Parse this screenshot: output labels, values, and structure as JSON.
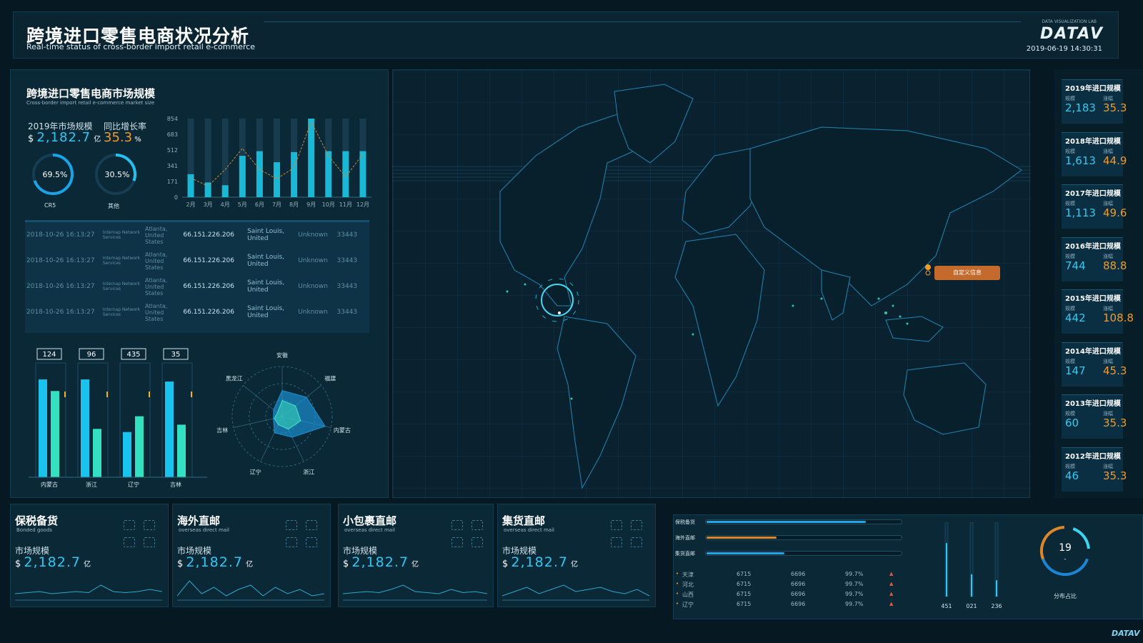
{
  "header": {
    "title": "跨境进口零售电商状况分析",
    "subtitle": "Real-time status of cross-border import retail e-commerce",
    "logo_small": "DATA VISUALIZATION LAB",
    "logo": "DATAV",
    "datetime": "2019-06-19 14:30:31"
  },
  "market": {
    "title": "跨境进口零售电商市场规模",
    "subtitle": "Cross-border import retail e-commerce market size",
    "scale_label": "2019年市场规模",
    "scale_currency": "$",
    "scale_value": "2,182.7",
    "scale_unit": "亿",
    "growth_label": "同比增长率",
    "growth_value": "35.3",
    "growth_unit": "%",
    "gauges": [
      {
        "label": "CR5",
        "value": "69.5%",
        "fraction": 0.695
      },
      {
        "label": "其他",
        "value": "30.5%",
        "fraction": 0.305
      }
    ]
  },
  "chart_data": [
    {
      "type": "bar",
      "categories": [
        "2月",
        "3月",
        "4月",
        "5月",
        "6月",
        "7月",
        "8月",
        "9月",
        "10月",
        "11月",
        "12月"
      ],
      "series": [
        {
          "values": [
            250,
            160,
            130,
            450,
            500,
            380,
            490,
            854,
            500,
            500,
            500
          ]
        }
      ],
      "line_values": [
        210,
        120,
        300,
        530,
        300,
        200,
        320,
        820,
        450,
        220,
        470
      ],
      "yticks": [
        "854",
        "683",
        "512",
        "341",
        "171",
        "0"
      ],
      "ylim": [
        0,
        854
      ]
    },
    {
      "type": "bar",
      "categories": [
        "内蒙古",
        "浙江",
        "辽宁",
        "吉林"
      ],
      "series": [
        {
          "values": [
            124,
            96,
            435,
            35
          ],
          "top_labels": [
            "124",
            "96",
            "435",
            "35"
          ]
        },
        {
          "values": [
            0.93,
            0.93,
            0.43,
            0.91
          ]
        },
        {
          "values": [
            0.82,
            0.46,
            0.58,
            0.5
          ]
        }
      ]
    },
    {
      "type": "radar",
      "axes": [
        "安徽",
        "福建",
        "内蒙古",
        "浙江",
        "辽宁",
        "吉林",
        "黑龙江"
      ],
      "series": [
        {
          "values": [
            0.52,
            0.62,
            0.88,
            0.46,
            0.36,
            0.18,
            0.22
          ]
        },
        {
          "values": [
            0.32,
            0.34,
            0.38,
            0.28,
            0.18,
            0.16,
            0.12
          ]
        }
      ]
    }
  ],
  "log_rows": [
    {
      "time": "2018-10-26 16:13:27",
      "org": "Internap Network Services",
      "city": "Atlanta, United States",
      "ip": "66.151.226.206",
      "dest": "Saint Louis, United",
      "status": "Unknown",
      "port": "33443"
    },
    {
      "time": "2018-10-26 16:13:27",
      "org": "Internap Network Services",
      "city": "Atlanta, United States",
      "ip": "66.151.226.206",
      "dest": "Saint Louis, United",
      "status": "Unknown",
      "port": "33443"
    },
    {
      "time": "2018-10-26 16:13:27",
      "org": "Internap Network Services",
      "city": "Atlanta, United States",
      "ip": "66.151.226.206",
      "dest": "Saint Louis, United",
      "status": "Unknown",
      "port": "33443"
    },
    {
      "time": "2018-10-26 16:13:27",
      "org": "Internap Network Services",
      "city": "Atlanta, United States",
      "ip": "66.151.226.206",
      "dest": "Saint Louis, United",
      "status": "Unknown",
      "port": "33443"
    }
  ],
  "map": {
    "tooltip": "自定义信息"
  },
  "yearly": [
    {
      "title": "2019年进口规模",
      "l1": "规模",
      "l2": "涨幅",
      "v1": "2,183",
      "v2": "35.3"
    },
    {
      "title": "2018年进口规模",
      "l1": "规模",
      "l2": "涨幅",
      "v1": "1,613",
      "v2": "44.9"
    },
    {
      "title": "2017年进口规模",
      "l1": "规模",
      "l2": "涨幅",
      "v1": "1,113",
      "v2": "49.6"
    },
    {
      "title": "2016年进口规模",
      "l1": "规模",
      "l2": "涨幅",
      "v1": "744",
      "v2": "88.8"
    },
    {
      "title": "2015年进口规模",
      "l1": "规模",
      "l2": "涨幅",
      "v1": "442",
      "v2": "108.8"
    },
    {
      "title": "2014年进口规模",
      "l1": "规模",
      "l2": "涨幅",
      "v1": "147",
      "v2": "45.3"
    },
    {
      "title": "2013年进口规模",
      "l1": "规模",
      "l2": "涨幅",
      "v1": "60",
      "v2": "35.3"
    },
    {
      "title": "2012年进口规模",
      "l1": "规模",
      "l2": "涨幅",
      "v1": "46",
      "v2": "35.3"
    }
  ],
  "bottom_cards": [
    {
      "title": "保税备货",
      "subtitle": "Bonded goods",
      "label": "市场规模",
      "currency": "$",
      "value": "2,182.7",
      "unit": "亿"
    },
    {
      "title": "海外直邮",
      "subtitle": "overseas direct mail",
      "label": "市场规模",
      "currency": "$",
      "value": "2,182.7",
      "unit": "亿"
    },
    {
      "title": "小包裹直邮",
      "subtitle": "overseas direct mail",
      "label": "市场规模",
      "currency": "$",
      "value": "2,182.7",
      "unit": "亿"
    },
    {
      "title": "集货直邮",
      "subtitle": "overseas direct mail",
      "label": "市场规模",
      "currency": "$",
      "value": "2,182.7",
      "unit": "亿"
    }
  ],
  "progress": [
    {
      "label": "保税备货",
      "fraction": 0.82,
      "color": "#1ea7e8"
    },
    {
      "label": "海外直邮",
      "fraction": 0.36,
      "color": "#e0862a"
    },
    {
      "label": "集货直邮",
      "fraction": 0.4,
      "color": "#1ea7e8"
    }
  ],
  "province_table": [
    {
      "name": "天津",
      "a": "6715",
      "b": "6696",
      "pct": "99.7%"
    },
    {
      "name": "河北",
      "a": "6715",
      "b": "6696",
      "pct": "99.7%"
    },
    {
      "name": "山西",
      "a": "6715",
      "b": "6696",
      "pct": "99.7%"
    },
    {
      "name": "辽宁",
      "a": "6715",
      "b": "6696",
      "pct": "99.7%"
    }
  ],
  "vbars": [
    {
      "label": "451",
      "fraction": 0.72
    },
    {
      "label": "021",
      "fraction": 0.3
    },
    {
      "label": "236",
      "fraction": 0.22
    }
  ],
  "ring": {
    "value": "19",
    "dash": "-",
    "label": "分布占比"
  },
  "footer_logo": "DATAV"
}
